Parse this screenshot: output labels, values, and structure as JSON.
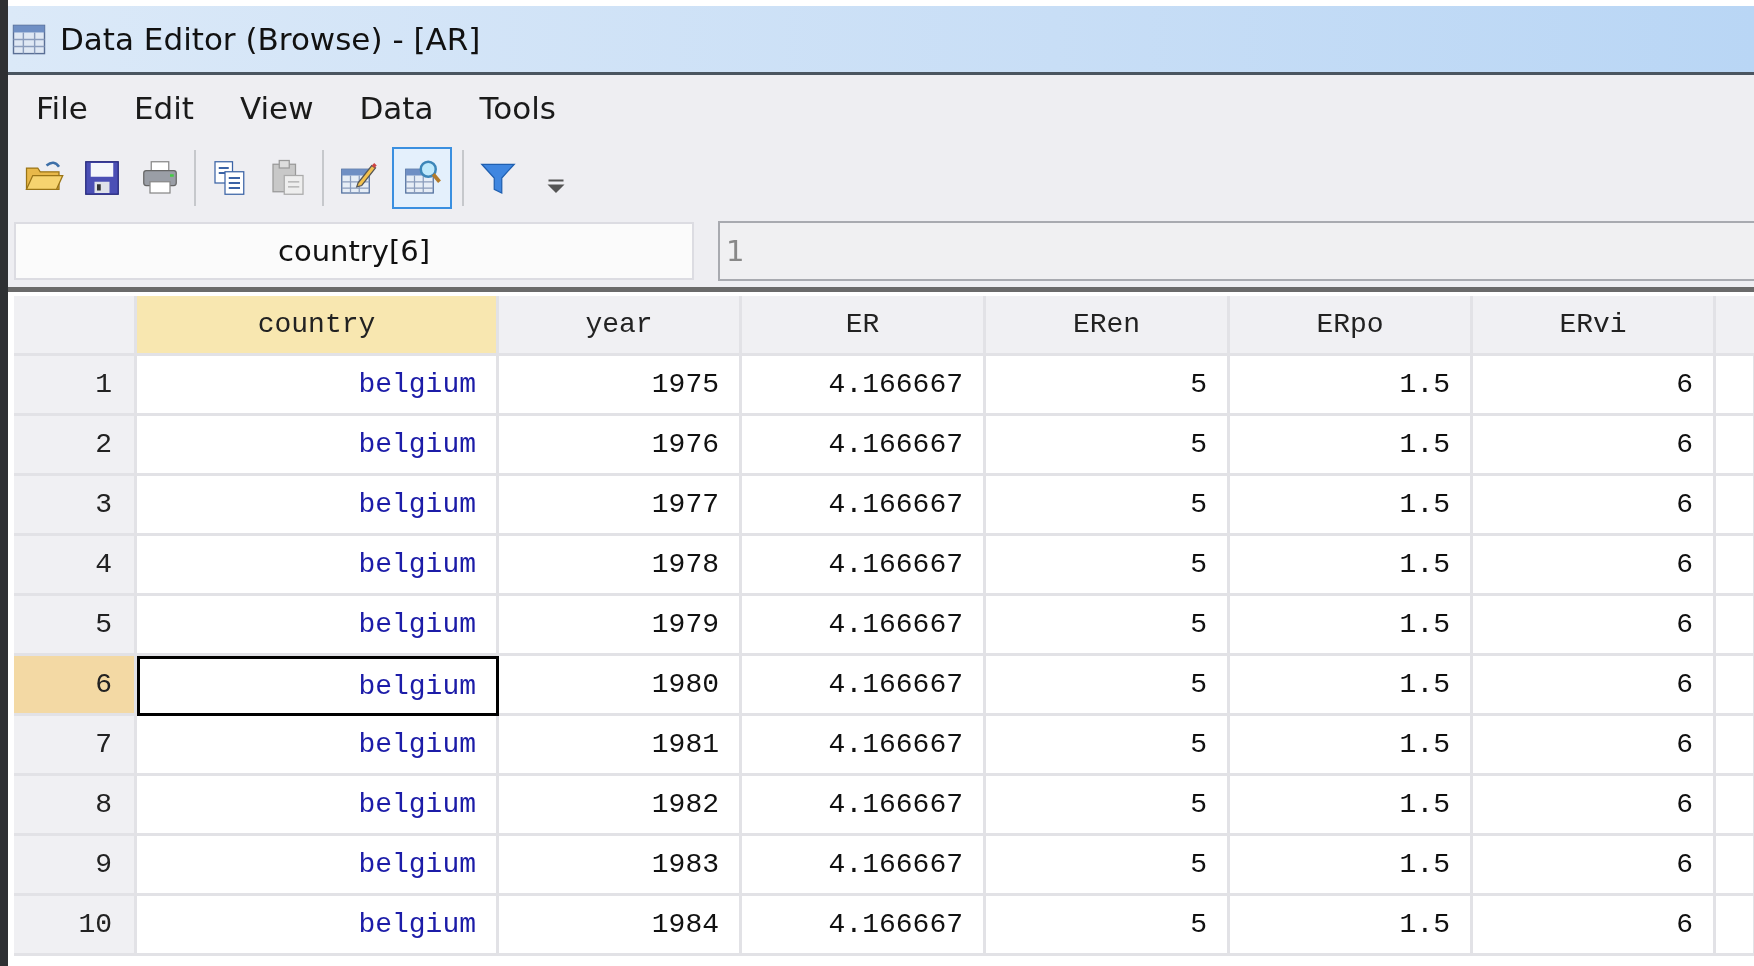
{
  "window": {
    "title": "Data Editor (Browse) - [AR]"
  },
  "menu": [
    "File",
    "Edit",
    "View",
    "Data",
    "Tools"
  ],
  "toolbar": [
    {
      "kind": "open",
      "selected": false
    },
    {
      "kind": "save",
      "selected": false
    },
    {
      "kind": "print",
      "selected": false
    },
    {
      "kind": "separator"
    },
    {
      "kind": "copy",
      "selected": false
    },
    {
      "kind": "paste",
      "selected": false
    },
    {
      "kind": "separator"
    },
    {
      "kind": "edit",
      "selected": false
    },
    {
      "kind": "browse",
      "selected": true
    },
    {
      "kind": "separator"
    },
    {
      "kind": "filter",
      "selected": false
    },
    {
      "kind": "more",
      "selected": false
    }
  ],
  "cell_name": "country[6]",
  "cell_value": "1",
  "table": {
    "columns": [
      {
        "name": "country",
        "kind": "string",
        "selected": true
      },
      {
        "name": "year",
        "kind": "numeric",
        "selected": false
      },
      {
        "name": "ER",
        "kind": "numeric",
        "selected": false
      },
      {
        "name": "ERen",
        "kind": "numeric",
        "selected": false
      },
      {
        "name": "ERpo",
        "kind": "numeric",
        "selected": false
      },
      {
        "name": "ERvi",
        "kind": "numeric",
        "selected": false
      }
    ],
    "rows": [
      {
        "number": "1",
        "selected": false,
        "cells": [
          "belgium",
          "1975",
          "4.166667",
          "5",
          "1.5",
          "6"
        ]
      },
      {
        "number": "2",
        "selected": false,
        "cells": [
          "belgium",
          "1976",
          "4.166667",
          "5",
          "1.5",
          "6"
        ]
      },
      {
        "number": "3",
        "selected": false,
        "cells": [
          "belgium",
          "1977",
          "4.166667",
          "5",
          "1.5",
          "6"
        ]
      },
      {
        "number": "4",
        "selected": false,
        "cells": [
          "belgium",
          "1978",
          "4.166667",
          "5",
          "1.5",
          "6"
        ]
      },
      {
        "number": "5",
        "selected": false,
        "cells": [
          "belgium",
          "1979",
          "4.166667",
          "5",
          "1.5",
          "6"
        ]
      },
      {
        "number": "6",
        "selected": true,
        "cells": [
          "belgium",
          "1980",
          "4.166667",
          "5",
          "1.5",
          "6"
        ]
      },
      {
        "number": "7",
        "selected": false,
        "cells": [
          "belgium",
          "1981",
          "4.166667",
          "5",
          "1.5",
          "6"
        ]
      },
      {
        "number": "8",
        "selected": false,
        "cells": [
          "belgium",
          "1982",
          "4.166667",
          "5",
          "1.5",
          "6"
        ]
      },
      {
        "number": "9",
        "selected": false,
        "cells": [
          "belgium",
          "1983",
          "4.166667",
          "5",
          "1.5",
          "6"
        ]
      },
      {
        "number": "10",
        "selected": false,
        "cells": [
          "belgium",
          "1984",
          "4.166667",
          "5",
          "1.5",
          "6"
        ]
      }
    ]
  }
}
